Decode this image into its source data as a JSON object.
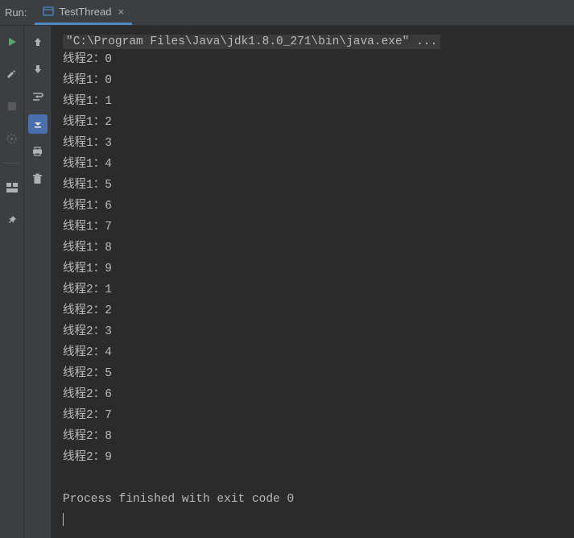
{
  "header": {
    "run_label": "Run:",
    "tab": {
      "label": "TestThread",
      "close": "×"
    }
  },
  "console": {
    "command": "\"C:\\Program Files\\Java\\jdk1.8.0_271\\bin\\java.exe\" ...",
    "lines": [
      "线程2：0",
      "线程1：0",
      "线程1：1",
      "线程1：2",
      "线程1：3",
      "线程1：4",
      "线程1：5",
      "线程1：6",
      "线程1：7",
      "线程1：8",
      "线程1：9",
      "线程2：1",
      "线程2：2",
      "线程2：3",
      "线程2：4",
      "线程2：5",
      "线程2：6",
      "线程2：7",
      "线程2：8",
      "线程2：9",
      "",
      "Process finished with exit code 0"
    ]
  },
  "colors": {
    "run_icon": "#59a869",
    "default_icon": "#afb1b3",
    "panel": "#3c3f41",
    "accent": "#4a88c7"
  }
}
